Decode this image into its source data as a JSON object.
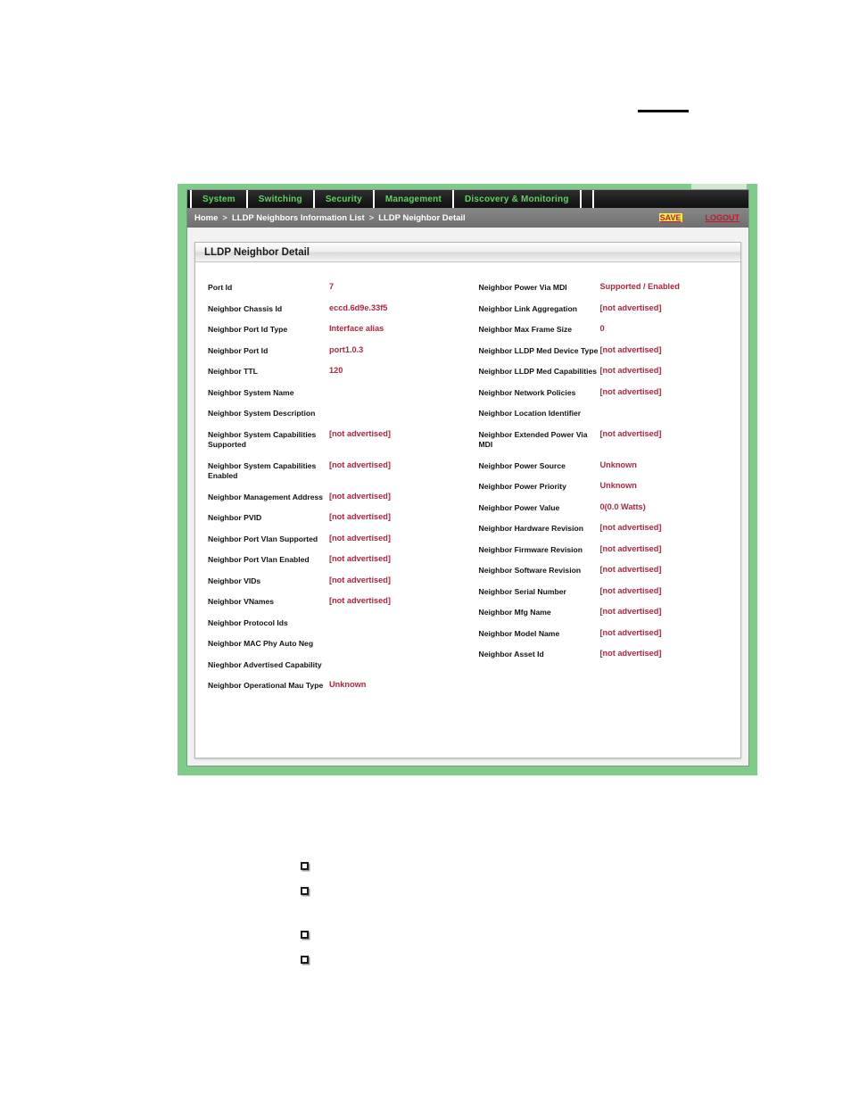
{
  "page": {
    "top_rule": "horizontal-rule"
  },
  "nav": {
    "tabs": [
      {
        "label": "System"
      },
      {
        "label": "Switching"
      },
      {
        "label": "Security"
      },
      {
        "label": "Management"
      },
      {
        "label": "Discovery & Monitoring"
      }
    ]
  },
  "breadcrumb": {
    "items": [
      {
        "label": "Home"
      },
      {
        "label": "LLDP Neighbors Information List"
      },
      {
        "label": "LLDP Neighbor Detail"
      }
    ],
    "separator": ">",
    "save_label": "SAVE",
    "logout_label": "LOGOUT"
  },
  "panel": {
    "title": "LLDP Neighbor Detail"
  },
  "detail": {
    "left": [
      {
        "label": "Port Id",
        "value": "7"
      },
      {
        "label": "Neighbor Chassis Id",
        "value": "eccd.6d9e.33f5"
      },
      {
        "label": "Neighbor Port Id Type",
        "value": "Interface alias"
      },
      {
        "label": "Neighbor Port Id",
        "value": "port1.0.3"
      },
      {
        "label": "Neighbor TTL",
        "value": "120"
      },
      {
        "label": "Neighbor System Name",
        "value": ""
      },
      {
        "label": "Neighbor System Description",
        "value": ""
      },
      {
        "label": "Neighbor System Capabilities Supported",
        "value": "[not advertised]"
      },
      {
        "label": "Neighbor System Capabilities Enabled",
        "value": "[not advertised]"
      },
      {
        "label": "Neighbor Management Address",
        "value": "[not advertised]"
      },
      {
        "label": "Neighbor PVID",
        "value": "[not advertised]"
      },
      {
        "label": "Neighbor Port Vlan Supported",
        "value": "[not advertised]"
      },
      {
        "label": "Neighbor Port Vlan Enabled",
        "value": "[not advertised]"
      },
      {
        "label": "Neighbor VIDs",
        "value": "[not advertised]"
      },
      {
        "label": "Neighbor VNames",
        "value": "[not advertised]"
      },
      {
        "label": "Neighbor Protocol Ids",
        "value": ""
      },
      {
        "label": "Neighbor MAC Phy Auto Neg",
        "value": ""
      },
      {
        "label": "Nieghbor Advertised Capability",
        "value": ""
      },
      {
        "label": "Neighbor Operational Mau Type",
        "value": "Unknown"
      }
    ],
    "right": [
      {
        "label": "Neighbor Power Via MDI",
        "value": "Supported / Enabled"
      },
      {
        "label": "Neighbor Link Aggregation",
        "value": "[not advertised]"
      },
      {
        "label": "Neighbor Max Frame Size",
        "value": "0"
      },
      {
        "label": "Neighbor LLDP Med Device Type",
        "value": "[not advertised]"
      },
      {
        "label": "Neighbor LLDP Med Capabilities",
        "value": "[not advertised]"
      },
      {
        "label": "Neighbor Network Policies",
        "value": "[not advertised]"
      },
      {
        "label": "Neighbor Location Identifier",
        "value": ""
      },
      {
        "label": "Neighbor Extended Power Via MDI",
        "value": "[not advertised]"
      },
      {
        "label": "Neighbor Power Source",
        "value": "Unknown"
      },
      {
        "label": "Neighbor Power Priority",
        "value": "Unknown"
      },
      {
        "label": "Neighbor Power Value",
        "value": "0(0.0 Watts)"
      },
      {
        "label": "Neighbor Hardware Revision",
        "value": "[not advertised]"
      },
      {
        "label": "Neighbor Firmware Revision",
        "value": "[not advertised]"
      },
      {
        "label": "Neighbor Software Revision",
        "value": "[not advertised]"
      },
      {
        "label": "Neighbor Serial Number",
        "value": "[not advertised]"
      },
      {
        "label": "Neighbor Mfg Name",
        "value": "[not advertised]"
      },
      {
        "label": "Neighbor Model Name",
        "value": "[not advertised]"
      },
      {
        "label": "Neighbor Asset Id",
        "value": "[not advertised]"
      }
    ]
  },
  "bullets": [
    {
      "name": "square-bullet"
    },
    {
      "name": "square-bullet"
    },
    {
      "name": "square-bullet"
    },
    {
      "name": "square-bullet"
    }
  ],
  "colors": {
    "frame_green": "#7ecb8a",
    "tab_text_green": "#5fd35f",
    "value_red": "#b5243c",
    "save_highlight": "#f2f24a",
    "nav_bar_dark": "#1d1d1d",
    "breadcrumb_gray": "#7c7c7c"
  }
}
